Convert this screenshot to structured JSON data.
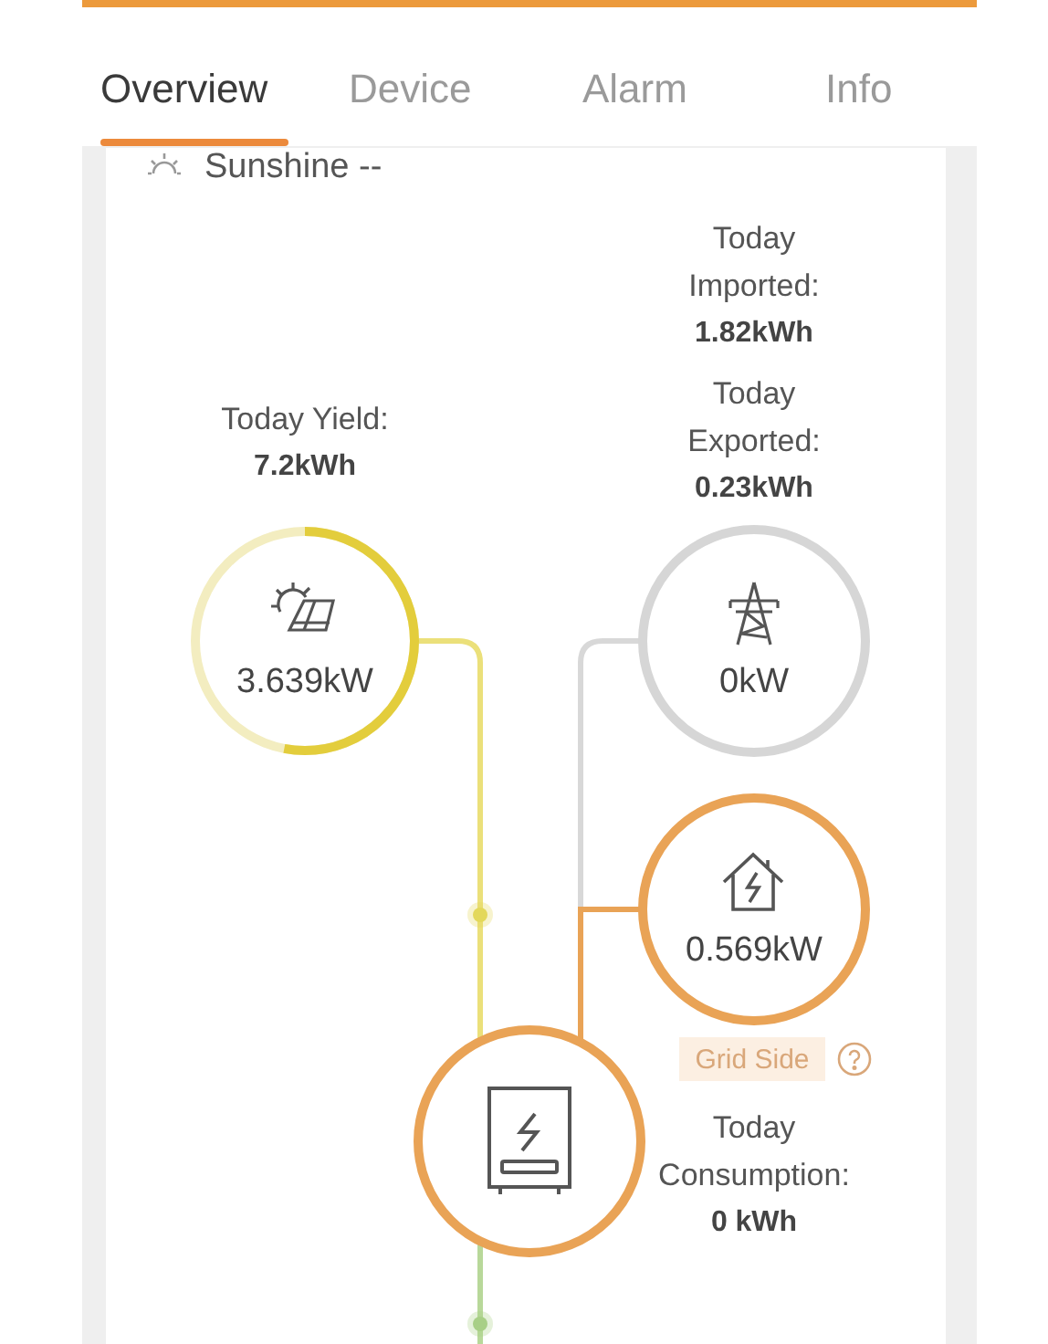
{
  "tabs": [
    {
      "label": "Overview",
      "selected": true
    },
    {
      "label": "Device",
      "selected": false
    },
    {
      "label": "Alarm",
      "selected": false
    },
    {
      "label": "Info",
      "selected": false
    }
  ],
  "weather": {
    "label": "Sunshine --"
  },
  "yield": {
    "label": "Today Yield:",
    "value": "7.2kWh"
  },
  "grid_stats": [
    {
      "label": "Today Imported:",
      "value": "1.82kWh"
    },
    {
      "label": "Today Exported:",
      "value": "0.23kWh"
    }
  ],
  "nodes": [
    {
      "kind": "solar",
      "value": "3.639kW",
      "color": "#e3cd3c"
    },
    {
      "kind": "grid",
      "value": "0kW",
      "color": "#d6d6d6"
    },
    {
      "kind": "home",
      "value": "0.569kW",
      "color": "#e9a356"
    },
    {
      "kind": "inverter",
      "color": "#e9a356"
    }
  ],
  "grid_side": {
    "label": "Grid Side"
  },
  "consumption": {
    "label": "Today Consumption:",
    "value": "0 kWh"
  }
}
